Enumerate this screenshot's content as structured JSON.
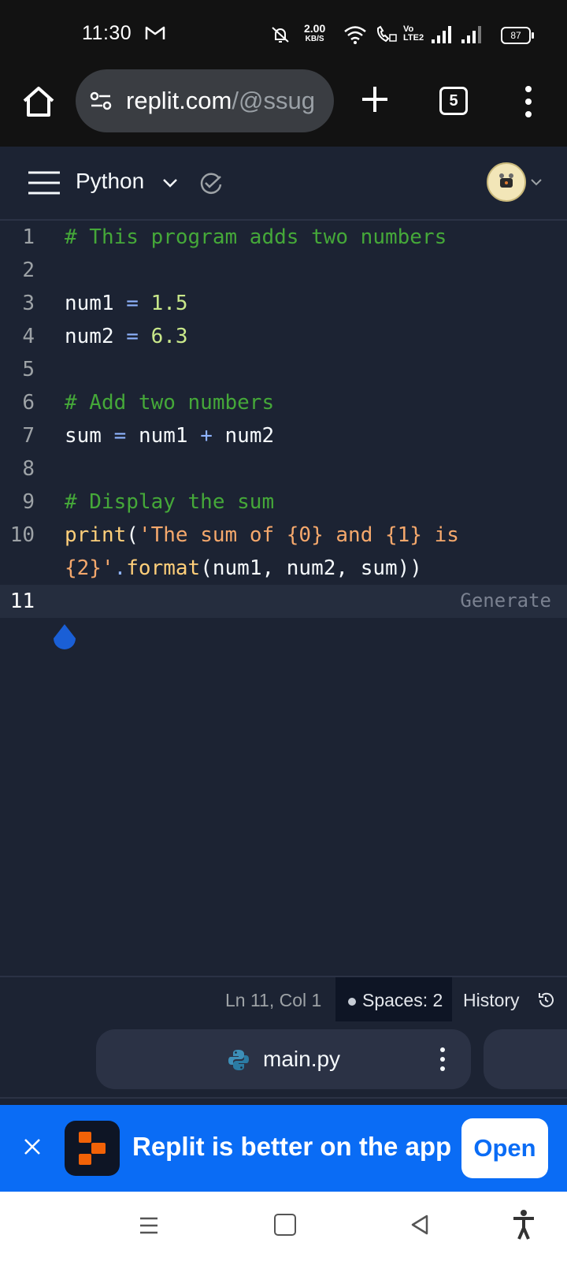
{
  "status_bar": {
    "time": "11:30",
    "speed_value": "2.00",
    "speed_unit": "KB/S",
    "battery": "87"
  },
  "browser": {
    "url_domain": "replit.com",
    "url_path": "/@ssug",
    "tab_count": "5"
  },
  "header": {
    "language": "Python"
  },
  "editor": {
    "lines": [
      {
        "num": "1"
      },
      {
        "num": "2"
      },
      {
        "num": "3"
      },
      {
        "num": "4"
      },
      {
        "num": "5"
      },
      {
        "num": "6"
      },
      {
        "num": "7"
      },
      {
        "num": "8"
      },
      {
        "num": "9"
      },
      {
        "num": "10"
      },
      {
        "num": "11"
      }
    ],
    "code": {
      "l1_comment": "# This program adds two numbers",
      "l3_var": "num1",
      "l3_eq": " = ",
      "l3_val": "1.5",
      "l4_var": "num2",
      "l4_eq": " = ",
      "l4_val": "6.3",
      "l6_comment": "# Add two numbers",
      "l7_a": "sum",
      "l7_eq": " = ",
      "l7_b": "num1",
      "l7_plus": " + ",
      "l7_c": "num2",
      "l9_comment": "# Display the sum",
      "l10_fn": "print",
      "l10_paren": "(",
      "l10_str": "'The sum of {0} and {1} is",
      "l10b_str": "{2}'",
      "l10b_dot": ".",
      "l10b_fn": "format",
      "l10b_args": "(num1, num2, sum))"
    },
    "generate_label": "Generate"
  },
  "status_line": {
    "position": "Ln 11, Col 1",
    "spaces": "Spaces: 2",
    "history": "History"
  },
  "file_tab": {
    "name": "main.py"
  },
  "banner": {
    "text": "Replit is better on the app",
    "open_label": "Open"
  }
}
